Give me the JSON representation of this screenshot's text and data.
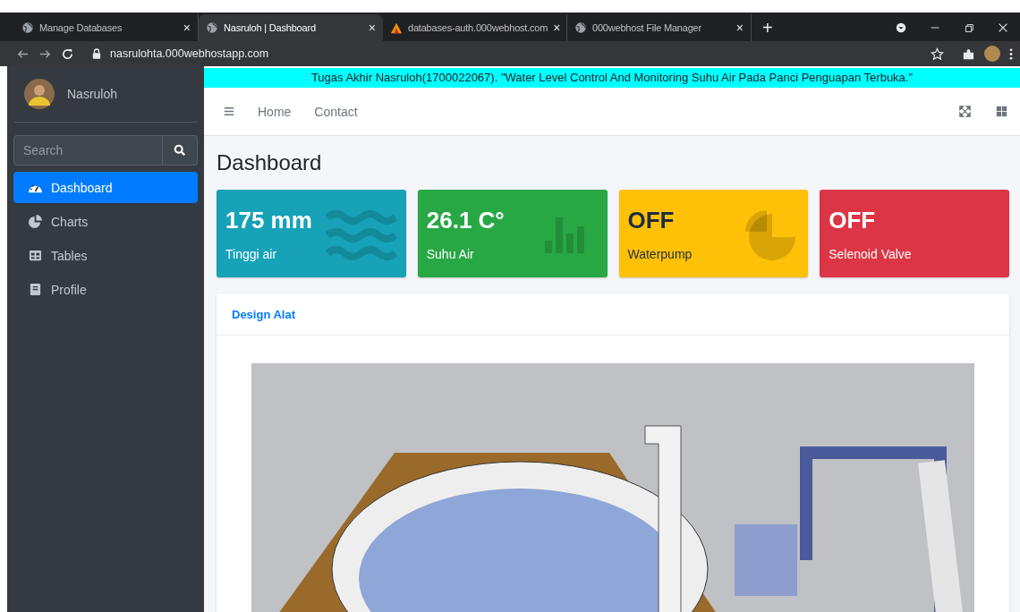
{
  "browser": {
    "tabs": [
      {
        "title": "Manage Databases",
        "selected": false,
        "kind": "globe",
        "close": "×"
      },
      {
        "title": "Nasruloh | Dashboard",
        "selected": true,
        "kind": "globe",
        "close": "×"
      },
      {
        "title": "databases-auth.000webhost.com",
        "selected": false,
        "kind": "logo",
        "close": "×"
      },
      {
        "title": "000webhost File Manager",
        "selected": false,
        "kind": "globe",
        "close": "×"
      }
    ],
    "new_tab": "+",
    "url": "nasrulohta.000webhostapp.com"
  },
  "sidebar": {
    "user": "Nasruloh",
    "search": {
      "placeholder": "Search"
    },
    "items": [
      {
        "label": "Dashboard",
        "selected": true,
        "kind": "gauge"
      },
      {
        "label": "Charts",
        "selected": false,
        "kind": "pie"
      },
      {
        "label": "Tables",
        "selected": false,
        "kind": "table"
      },
      {
        "label": "Profile",
        "selected": false,
        "kind": "book"
      }
    ]
  },
  "banner": "Tugas Akhir Nasruloh(1700022067). \"Water Level Control And Monitoring Suhu Air Pada Panci Penguapan Terbuka.\"",
  "navbar": {
    "links": [
      "Home",
      "Contact"
    ]
  },
  "page_title": "Dashboard",
  "info_boxes": [
    {
      "value": "175 mm",
      "label": "Tinggi air",
      "color": "#17a2b8",
      "kind": "waves"
    },
    {
      "value": "26.1 C°",
      "label": "Suhu Air",
      "color": "#28a745",
      "kind": "bars"
    },
    {
      "value": "OFF",
      "label": "Waterpump",
      "color": "#ffc107",
      "kind": "pie"
    },
    {
      "value": "OFF",
      "label": "Selenoid Valve",
      "color": "#dc3545",
      "kind": "none"
    }
  ],
  "card": {
    "title": "Design Alat"
  }
}
